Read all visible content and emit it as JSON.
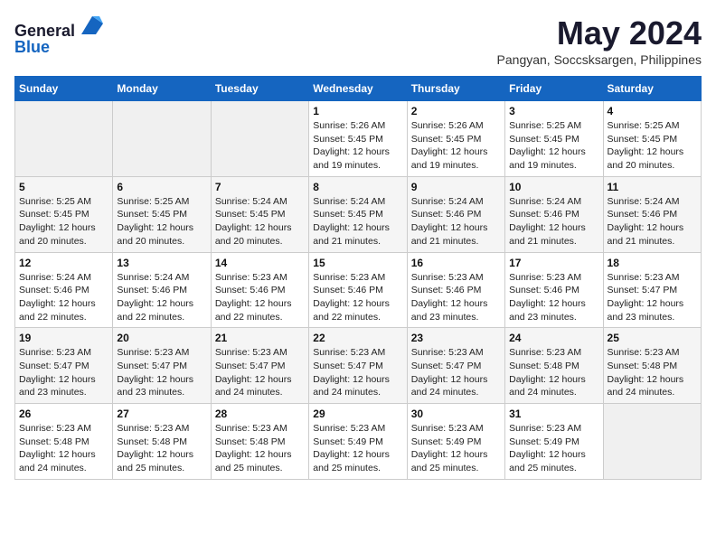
{
  "header": {
    "logo_line1": "General",
    "logo_line2": "Blue",
    "month_year": "May 2024",
    "location": "Pangyan, Soccsksargen, Philippines"
  },
  "weekdays": [
    "Sunday",
    "Monday",
    "Tuesday",
    "Wednesday",
    "Thursday",
    "Friday",
    "Saturday"
  ],
  "weeks": [
    [
      {
        "day": "",
        "info": ""
      },
      {
        "day": "",
        "info": ""
      },
      {
        "day": "",
        "info": ""
      },
      {
        "day": "1",
        "info": "Sunrise: 5:26 AM\nSunset: 5:45 PM\nDaylight: 12 hours\nand 19 minutes."
      },
      {
        "day": "2",
        "info": "Sunrise: 5:26 AM\nSunset: 5:45 PM\nDaylight: 12 hours\nand 19 minutes."
      },
      {
        "day": "3",
        "info": "Sunrise: 5:25 AM\nSunset: 5:45 PM\nDaylight: 12 hours\nand 19 minutes."
      },
      {
        "day": "4",
        "info": "Sunrise: 5:25 AM\nSunset: 5:45 PM\nDaylight: 12 hours\nand 20 minutes."
      }
    ],
    [
      {
        "day": "5",
        "info": "Sunrise: 5:25 AM\nSunset: 5:45 PM\nDaylight: 12 hours\nand 20 minutes."
      },
      {
        "day": "6",
        "info": "Sunrise: 5:25 AM\nSunset: 5:45 PM\nDaylight: 12 hours\nand 20 minutes."
      },
      {
        "day": "7",
        "info": "Sunrise: 5:24 AM\nSunset: 5:45 PM\nDaylight: 12 hours\nand 20 minutes."
      },
      {
        "day": "8",
        "info": "Sunrise: 5:24 AM\nSunset: 5:45 PM\nDaylight: 12 hours\nand 21 minutes."
      },
      {
        "day": "9",
        "info": "Sunrise: 5:24 AM\nSunset: 5:46 PM\nDaylight: 12 hours\nand 21 minutes."
      },
      {
        "day": "10",
        "info": "Sunrise: 5:24 AM\nSunset: 5:46 PM\nDaylight: 12 hours\nand 21 minutes."
      },
      {
        "day": "11",
        "info": "Sunrise: 5:24 AM\nSunset: 5:46 PM\nDaylight: 12 hours\nand 21 minutes."
      }
    ],
    [
      {
        "day": "12",
        "info": "Sunrise: 5:24 AM\nSunset: 5:46 PM\nDaylight: 12 hours\nand 22 minutes."
      },
      {
        "day": "13",
        "info": "Sunrise: 5:24 AM\nSunset: 5:46 PM\nDaylight: 12 hours\nand 22 minutes."
      },
      {
        "day": "14",
        "info": "Sunrise: 5:23 AM\nSunset: 5:46 PM\nDaylight: 12 hours\nand 22 minutes."
      },
      {
        "day": "15",
        "info": "Sunrise: 5:23 AM\nSunset: 5:46 PM\nDaylight: 12 hours\nand 22 minutes."
      },
      {
        "day": "16",
        "info": "Sunrise: 5:23 AM\nSunset: 5:46 PM\nDaylight: 12 hours\nand 23 minutes."
      },
      {
        "day": "17",
        "info": "Sunrise: 5:23 AM\nSunset: 5:46 PM\nDaylight: 12 hours\nand 23 minutes."
      },
      {
        "day": "18",
        "info": "Sunrise: 5:23 AM\nSunset: 5:47 PM\nDaylight: 12 hours\nand 23 minutes."
      }
    ],
    [
      {
        "day": "19",
        "info": "Sunrise: 5:23 AM\nSunset: 5:47 PM\nDaylight: 12 hours\nand 23 minutes."
      },
      {
        "day": "20",
        "info": "Sunrise: 5:23 AM\nSunset: 5:47 PM\nDaylight: 12 hours\nand 23 minutes."
      },
      {
        "day": "21",
        "info": "Sunrise: 5:23 AM\nSunset: 5:47 PM\nDaylight: 12 hours\nand 24 minutes."
      },
      {
        "day": "22",
        "info": "Sunrise: 5:23 AM\nSunset: 5:47 PM\nDaylight: 12 hours\nand 24 minutes."
      },
      {
        "day": "23",
        "info": "Sunrise: 5:23 AM\nSunset: 5:47 PM\nDaylight: 12 hours\nand 24 minutes."
      },
      {
        "day": "24",
        "info": "Sunrise: 5:23 AM\nSunset: 5:48 PM\nDaylight: 12 hours\nand 24 minutes."
      },
      {
        "day": "25",
        "info": "Sunrise: 5:23 AM\nSunset: 5:48 PM\nDaylight: 12 hours\nand 24 minutes."
      }
    ],
    [
      {
        "day": "26",
        "info": "Sunrise: 5:23 AM\nSunset: 5:48 PM\nDaylight: 12 hours\nand 24 minutes."
      },
      {
        "day": "27",
        "info": "Sunrise: 5:23 AM\nSunset: 5:48 PM\nDaylight: 12 hours\nand 25 minutes."
      },
      {
        "day": "28",
        "info": "Sunrise: 5:23 AM\nSunset: 5:48 PM\nDaylight: 12 hours\nand 25 minutes."
      },
      {
        "day": "29",
        "info": "Sunrise: 5:23 AM\nSunset: 5:49 PM\nDaylight: 12 hours\nand 25 minutes."
      },
      {
        "day": "30",
        "info": "Sunrise: 5:23 AM\nSunset: 5:49 PM\nDaylight: 12 hours\nand 25 minutes."
      },
      {
        "day": "31",
        "info": "Sunrise: 5:23 AM\nSunset: 5:49 PM\nDaylight: 12 hours\nand 25 minutes."
      },
      {
        "day": "",
        "info": ""
      }
    ]
  ]
}
